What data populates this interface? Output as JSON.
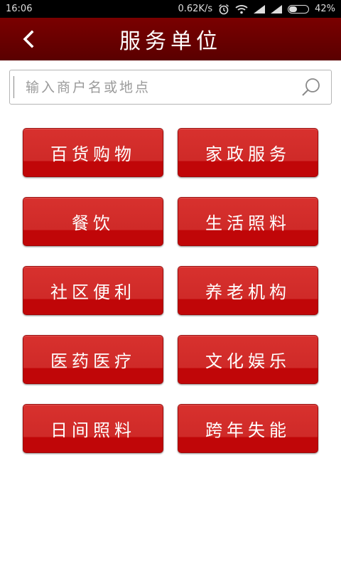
{
  "status_bar": {
    "time": "16:06",
    "net_speed": "0.62K/s",
    "battery_percent": "42%",
    "icons": [
      "alarm-icon",
      "wifi-icon",
      "signal-icon",
      "signal-icon",
      "battery-icon"
    ]
  },
  "header": {
    "title": "服务单位",
    "back_icon": "chevron-left-icon",
    "background": "#6a0000"
  },
  "search": {
    "placeholder": "输入商户名或地点",
    "value": ""
  },
  "categories": [
    {
      "label": "百货购物"
    },
    {
      "label": "家政服务"
    },
    {
      "label": "餐饮"
    },
    {
      "label": "生活照料"
    },
    {
      "label": "社区便利"
    },
    {
      "label": "养老机构"
    },
    {
      "label": "医药医疗"
    },
    {
      "label": "文化娱乐"
    },
    {
      "label": "日间照料"
    },
    {
      "label": "跨年失能"
    }
  ],
  "colors": {
    "button_red": "#d02a28",
    "title_bar": "#6a0000"
  }
}
